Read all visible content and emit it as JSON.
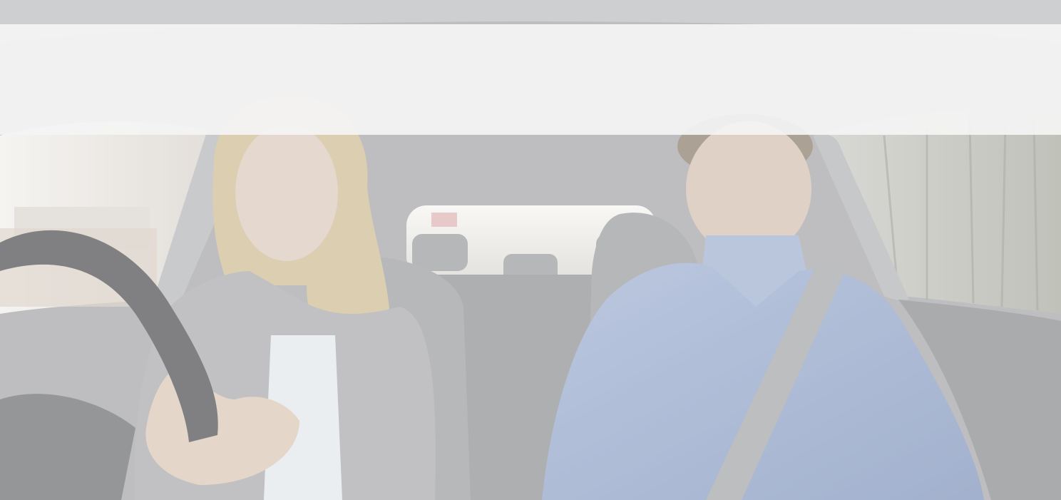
{
  "scene": {
    "description_colors": {
      "roof": "#bdbec1",
      "band": "#f3f3f3",
      "interior": "#8e8f91",
      "sweater": "#8fa3c9",
      "cardigan": "#a9a9ab",
      "hair": "#c9b98f",
      "skin": "#d7c4b6",
      "window_left": "#e7e3de",
      "window_right": "#b8b9ad",
      "seatbelt": "#9b9c9e",
      "steering_wheel": "#4d4e50"
    }
  }
}
